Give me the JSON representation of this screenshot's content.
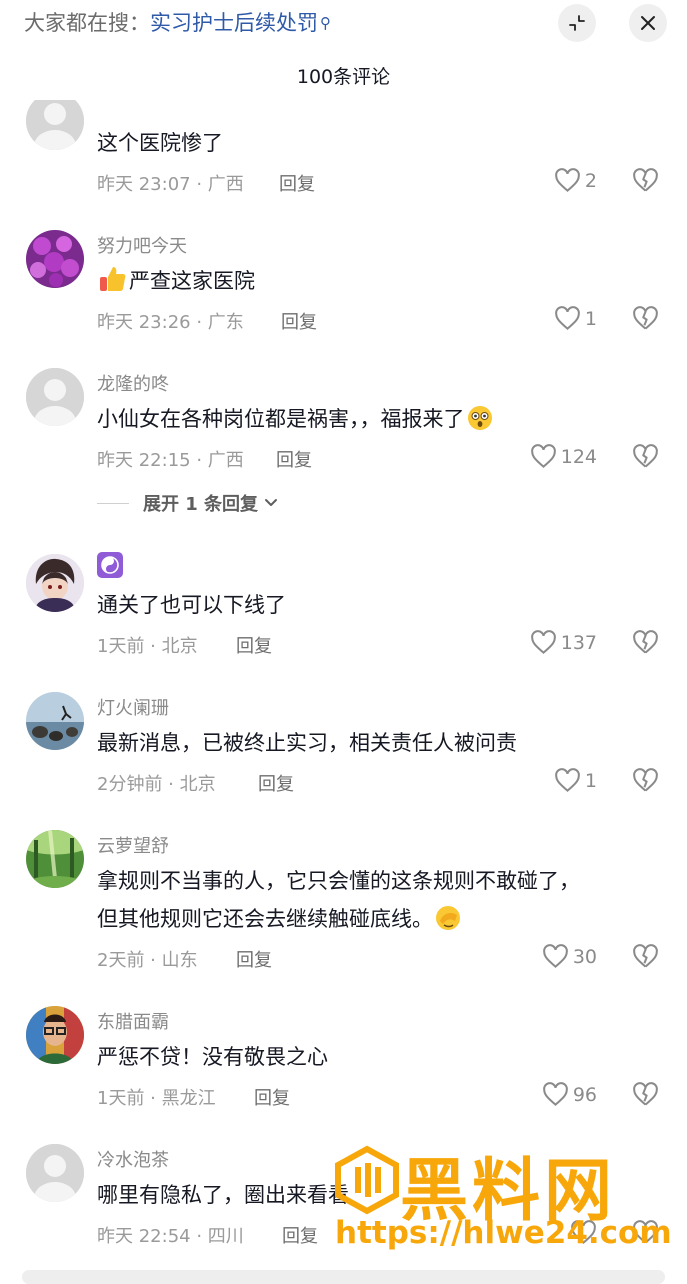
{
  "search": {
    "prefix": "大家都在搜：",
    "term": "实习护士后续处罚",
    "icon": "search-icon"
  },
  "comment_count": "100条评论",
  "comments": [
    {
      "username": "",
      "text": "这个医院惨了",
      "time": "昨天 23:07",
      "location": "广西",
      "reply": "回复",
      "likes": "2"
    },
    {
      "username": "努力吧今天",
      "text": "严查这家医院",
      "time": "昨天 23:26",
      "location": "广东",
      "reply": "回复",
      "likes": "1"
    },
    {
      "username": "龙隆的咚",
      "text": "小仙女在各种岗位都是祸害，，福报来了",
      "time": "昨天 22:15",
      "location": "广西",
      "reply": "回复",
      "likes": "124",
      "expand": "展开 1 条回复"
    },
    {
      "username": "",
      "text": "通关了也可以下线了",
      "time": "1天前",
      "location": "北京",
      "reply": "回复",
      "likes": "137"
    },
    {
      "username": "灯火阑珊",
      "text": "最新消息，已被终止实习，相关责任人被问责",
      "time": "2分钟前",
      "location": "北京",
      "reply": "回复",
      "likes": "1"
    },
    {
      "username": "云萝望舒",
      "text": "拿规则不当事的人，它只会懂的这条规则不敢碰了，",
      "text2": "但其他规则它还会去继续触碰底线。",
      "time": "2天前",
      "location": "山东",
      "reply": "回复",
      "likes": "30"
    },
    {
      "username": "东腊面霸",
      "text": "严惩不贷！没有敬畏之心",
      "time": "1天前",
      "location": "黑龙江",
      "reply": "回复",
      "likes": "96"
    },
    {
      "username": "冷水泡茶",
      "text": "哪里有隐私了，圈出来看看",
      "time": "昨天 22:54",
      "location": "四川",
      "reply": "回复",
      "likes": ""
    }
  ],
  "watermark": {
    "title": "黑料网",
    "url": "https://hlwe24.com"
  },
  "colors": {
    "accent_link": "#2f5aa8",
    "watermark": "#f7a70a"
  }
}
